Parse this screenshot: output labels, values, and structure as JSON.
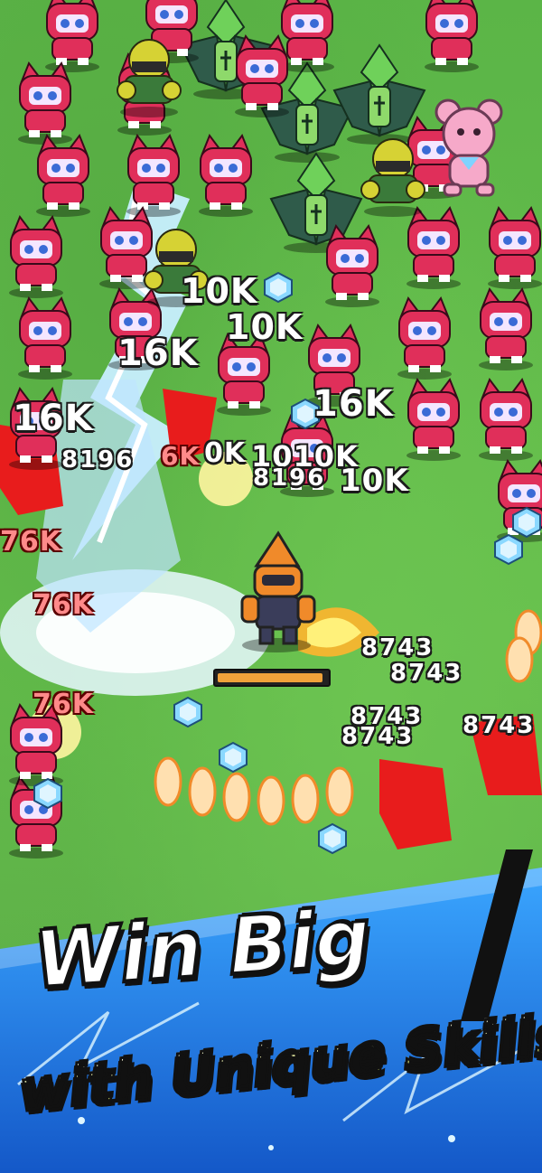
{
  "screen": {
    "title_line_1": "Win Big",
    "title_line_2": "with Unique Skills!"
  },
  "player": {
    "name_icon": "armored-hero-icon",
    "health_fraction": 0.97,
    "health_color": "#f0a23a"
  },
  "damage_numbers": [
    {
      "id": "dmg-1",
      "text": "10K",
      "style": "big"
    },
    {
      "id": "dmg-2",
      "text": "10K",
      "style": "big"
    },
    {
      "id": "dmg-3",
      "text": "16K",
      "style": "big"
    },
    {
      "id": "dmg-4",
      "text": "16K",
      "style": "big"
    },
    {
      "id": "dmg-5",
      "text": "16K",
      "style": "big"
    },
    {
      "id": "dmg-6",
      "text": "8196",
      "style": "small"
    },
    {
      "id": "dmg-7",
      "text": "6K",
      "style": "red"
    },
    {
      "id": "dmg-8",
      "text": "0K",
      "style": "big"
    },
    {
      "id": "dmg-9",
      "text": "1010K",
      "style": "big"
    },
    {
      "id": "dmg-10",
      "text": "8196",
      "style": "small"
    },
    {
      "id": "dmg-11",
      "text": "10K",
      "style": "big"
    },
    {
      "id": "dmg-12",
      "text": "76K",
      "style": "red"
    },
    {
      "id": "dmg-13",
      "text": "76K",
      "style": "red"
    },
    {
      "id": "dmg-14",
      "text": "76K",
      "style": "red"
    },
    {
      "id": "dmg-15",
      "text": "8743",
      "style": "small"
    },
    {
      "id": "dmg-16",
      "text": "8743",
      "style": "small"
    },
    {
      "id": "dmg-17",
      "text": "8743",
      "style": "small"
    },
    {
      "id": "dmg-18",
      "text": "8743",
      "style": "small"
    },
    {
      "id": "dmg-19",
      "text": "8743",
      "style": "small"
    }
  ],
  "colors": {
    "grass": "#5fb84a",
    "cat_enemy": "#e02f5a",
    "plant_enemy": "#2f5b4a",
    "beetle_enemy": "#d6d234",
    "gem": "#8ad8ff",
    "banner_blue": "#1e88e5",
    "title_yellow": "#f4ff9a"
  }
}
